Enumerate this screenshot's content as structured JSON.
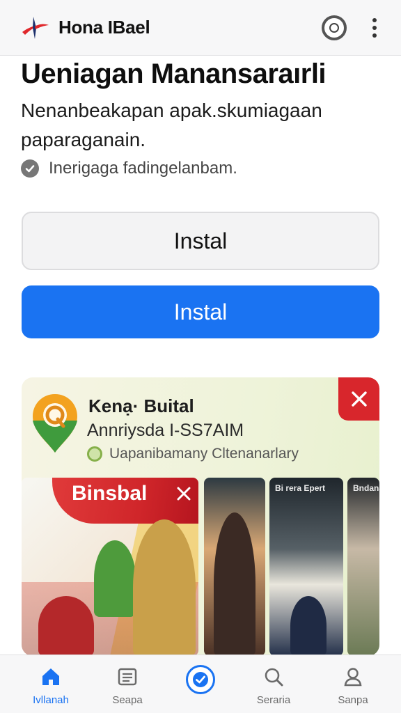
{
  "header": {
    "app_title": "Hona IBael"
  },
  "main": {
    "title": "Ueniagan Manansaraırli",
    "description": "Nenanbeakapan apak.skumiagaan paparaganain.",
    "check_text": "Inerigaga fadingelanbam.",
    "secondary_button_label": "Instal",
    "primary_button_label": "Instal"
  },
  "card": {
    "title": "Kenạ· Buital",
    "subtitle": "Annriysda I-SS7AIM",
    "note": "Uapanibamany Cltenanarlary",
    "banner_text": "Binsbal",
    "thumb3_label": "Bi rera Epert",
    "thumb4_label": "Bndana"
  },
  "bottom_nav": {
    "items": [
      {
        "label": "Ivllanah",
        "icon": "home-icon",
        "active": true
      },
      {
        "label": "Seapa",
        "icon": "list-icon",
        "active": false
      },
      {
        "label": "",
        "icon": "check-circle-icon",
        "active": false
      },
      {
        "label": "Seraria",
        "icon": "search-icon",
        "active": false
      },
      {
        "label": "Sanpa",
        "icon": "person-icon",
        "active": false
      }
    ]
  },
  "colors": {
    "primary": "#1a73f2",
    "close_red": "#d8262c",
    "logo_red": "#e0272b"
  }
}
